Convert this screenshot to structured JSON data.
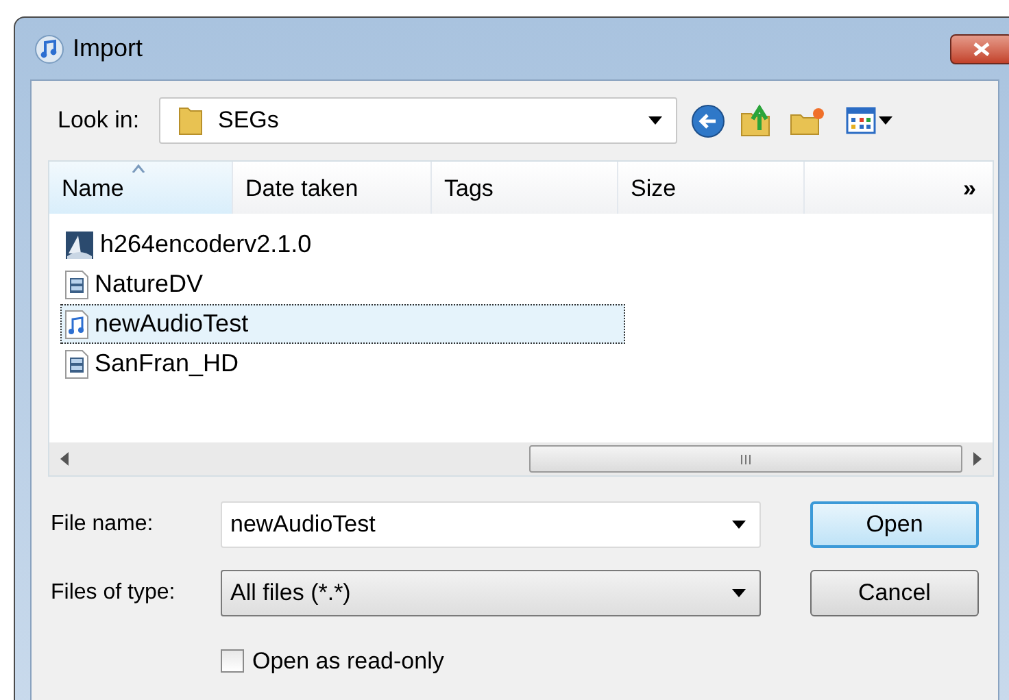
{
  "window": {
    "title": "Import"
  },
  "look_in": {
    "label": "Look in:",
    "value": "SEGs"
  },
  "columns": [
    {
      "label": "Name",
      "sorted": true
    },
    {
      "label": "Date taken",
      "sorted": false
    },
    {
      "label": "Tags",
      "sorted": false
    },
    {
      "label": "Size",
      "sorted": false
    }
  ],
  "columns_more": "»",
  "files": [
    {
      "name": "h264encoderv2.1.0",
      "kind": "app",
      "selected": false
    },
    {
      "name": "NatureDV",
      "kind": "video",
      "selected": false
    },
    {
      "name": "newAudioTest",
      "kind": "audio",
      "selected": true
    },
    {
      "name": "SanFran_HD",
      "kind": "video",
      "selected": false
    }
  ],
  "file_name": {
    "label": "File name:",
    "value": "newAudioTest"
  },
  "file_type": {
    "label": "Files of type:",
    "value": "All files (*.*)"
  },
  "read_only": {
    "label": "Open as read-only",
    "checked": false
  },
  "buttons": [
    {
      "label": "Open",
      "default": true
    },
    {
      "label": "Cancel",
      "default": false
    }
  ]
}
